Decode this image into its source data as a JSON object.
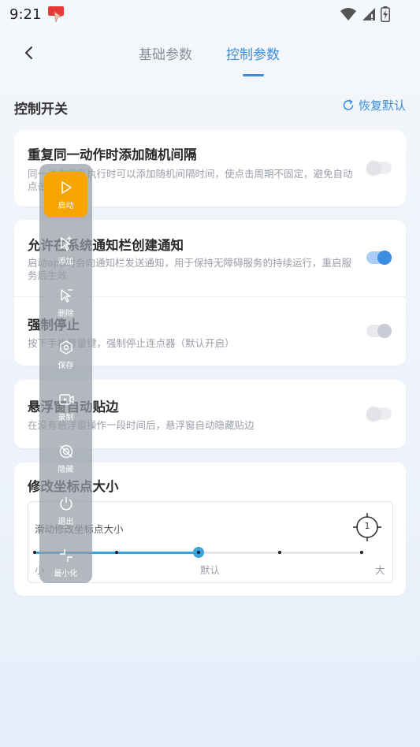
{
  "status": {
    "time": "9:21"
  },
  "header": {
    "tabs": [
      {
        "label": "基础参数",
        "active": false
      },
      {
        "label": "控制参数",
        "active": true
      }
    ]
  },
  "section": {
    "title": "控制开关",
    "restore_label": "恢复默认"
  },
  "settings": [
    {
      "title": "重复同一动作时添加随机间隔",
      "desc": "同一动作重复执行时可以添加随机间隔时间，使点击周期不固定，避免自动点击检测",
      "enabled": false
    },
    {
      "title": "允许在系统通知栏创建通知",
      "desc": "启动app时会向通知栏发送通知，用于保持无障碍服务的持续运行，重启服务后生效",
      "enabled": true
    },
    {
      "title": "强制停止",
      "desc": "按下手机音量键，强制停止连点器（默认开启）",
      "enabled": true,
      "disabled": true
    },
    {
      "title": "悬浮窗自动贴边",
      "desc": "在没有悬浮窗操作一段时间后，悬浮窗自动隐藏贴边",
      "enabled": false
    }
  ],
  "marker_size": {
    "title": "修改坐标点大小",
    "slider_label": "滑动修改坐标点大小",
    "preview_number": "1",
    "steps": 5,
    "selected_step": 2,
    "scale_labels": {
      "min": "小",
      "mid": "默认",
      "max": "大"
    }
  },
  "float_panel": {
    "items": [
      {
        "label": "启动",
        "icon": "play-icon"
      },
      {
        "label": "添加",
        "icon": "add-pointer-icon"
      },
      {
        "label": "删除",
        "icon": "delete-pointer-icon"
      },
      {
        "label": "保存",
        "icon": "save-icon"
      },
      {
        "label": "录制",
        "icon": "record-icon"
      },
      {
        "label": "隐藏",
        "icon": "hide-icon"
      },
      {
        "label": "退出",
        "icon": "exit-icon"
      },
      {
        "label": "最小化",
        "icon": "minimize-icon"
      }
    ]
  },
  "colors": {
    "accent": "#3a8de0",
    "start_button": "#f7a500",
    "slider": "#3aa3d9"
  }
}
